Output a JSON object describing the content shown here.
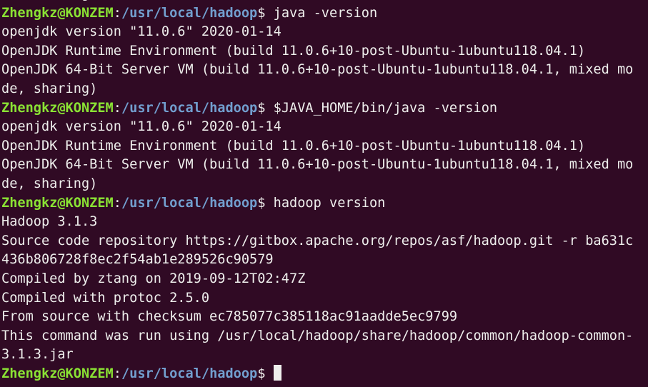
{
  "terminal": {
    "colors": {
      "background": "#300a24",
      "user_host": "#8ae234",
      "path": "#729fcf",
      "text": "#eeeeec"
    },
    "prompt": {
      "user_host": "Zhengkz@KONZEM",
      "separator": ":",
      "path": "/usr/local/hadoop",
      "symbol": "$ "
    },
    "lines": [
      {
        "type": "output",
        "text": "de, sharing)"
      },
      {
        "type": "prompt",
        "command": "java -version"
      },
      {
        "type": "output",
        "text": "openjdk version \"11.0.6\" 2020-01-14"
      },
      {
        "type": "output",
        "text": "OpenJDK Runtime Environment (build 11.0.6+10-post-Ubuntu-1ubuntu118.04.1)"
      },
      {
        "type": "output",
        "text": "OpenJDK 64-Bit Server VM (build 11.0.6+10-post-Ubuntu-1ubuntu118.04.1, mixed mo"
      },
      {
        "type": "output",
        "text": "de, sharing)"
      },
      {
        "type": "prompt",
        "command": "$JAVA_HOME/bin/java -version"
      },
      {
        "type": "output",
        "text": "openjdk version \"11.0.6\" 2020-01-14"
      },
      {
        "type": "output",
        "text": "OpenJDK Runtime Environment (build 11.0.6+10-post-Ubuntu-1ubuntu118.04.1)"
      },
      {
        "type": "output",
        "text": "OpenJDK 64-Bit Server VM (build 11.0.6+10-post-Ubuntu-1ubuntu118.04.1, mixed mo"
      },
      {
        "type": "output",
        "text": "de, sharing)"
      },
      {
        "type": "prompt",
        "command": "hadoop version"
      },
      {
        "type": "output",
        "text": "Hadoop 3.1.3"
      },
      {
        "type": "output",
        "text": "Source code repository https://gitbox.apache.org/repos/asf/hadoop.git -r ba631c"
      },
      {
        "type": "output",
        "text": "436b806728f8ec2f54ab1e289526c90579"
      },
      {
        "type": "output",
        "text": "Compiled by ztang on 2019-09-12T02:47Z"
      },
      {
        "type": "output",
        "text": "Compiled with protoc 2.5.0"
      },
      {
        "type": "output",
        "text": "From source with checksum ec785077c385118ac91aadde5ec9799"
      },
      {
        "type": "output",
        "text": "This command was run using /usr/local/hadoop/share/hadoop/common/hadoop-common-"
      },
      {
        "type": "output",
        "text": "3.1.3.jar"
      },
      {
        "type": "prompt",
        "command": "",
        "cursor": true
      }
    ]
  }
}
